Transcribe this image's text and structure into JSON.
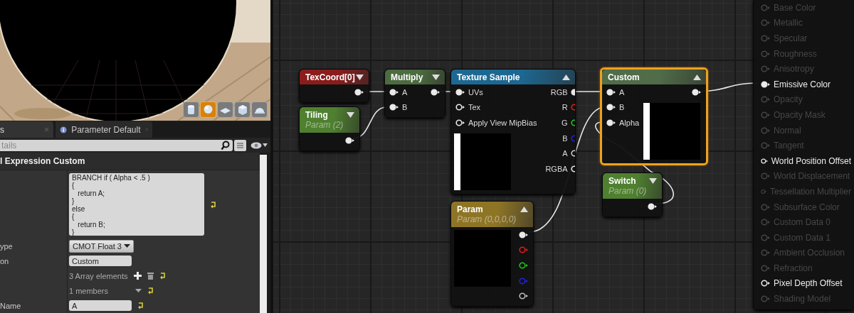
{
  "viewport": {
    "buttons": [
      {
        "selected": false
      },
      {
        "selected": true
      },
      {
        "selected": false
      },
      {
        "selected": false
      },
      {
        "selected": false
      }
    ]
  },
  "tabs": [
    {
      "label": "s",
      "selected": true
    },
    {
      "label": "Parameter Default",
      "selected": false
    }
  ],
  "search": {
    "placeholder": "tails"
  },
  "details": {
    "category": "l Expression Custom",
    "rows": [
      {
        "kind": "code",
        "lines": [
          "BRANCH if ( Alpha < .5 )",
          "{",
          "   return A;",
          "}",
          "else",
          "{",
          "   return B;",
          "}"
        ],
        "reset": true
      },
      {
        "kind": "dropdown",
        "label": "ype",
        "value": "CMOT Float 3",
        "reset": false
      },
      {
        "kind": "text",
        "label": "on",
        "value": "Custom",
        "reset": false
      },
      {
        "kind": "array",
        "text": "3 Array elements",
        "reset": true
      },
      {
        "kind": "members",
        "text": "1 members",
        "reset": true
      },
      {
        "kind": "text",
        "label": "Name",
        "value": "A",
        "reset": true
      }
    ]
  },
  "graph": {
    "nodes": [
      {
        "kind": "texcoord",
        "title": "TexCoord[0]",
        "preview": false,
        "selected": false,
        "outputs": [
          {
            "connected": true
          }
        ]
      },
      {
        "kind": "param",
        "title": "Tiling",
        "subtitle": "Param (2)",
        "preview": false,
        "selected": false,
        "outputs": [
          {
            "connected": true
          }
        ]
      },
      {
        "kind": "math",
        "title": "Multiply",
        "preview": false,
        "selected": false,
        "inputs": [
          {
            "label": "A",
            "connected": true
          },
          {
            "label": "B",
            "connected": true
          }
        ],
        "outputs": [
          {
            "connected": true
          }
        ]
      },
      {
        "kind": "texture",
        "title": "Texture Sample",
        "preview": true,
        "selected": false,
        "inputs": [
          {
            "label": "UVs",
            "connected": true
          },
          {
            "label": "Tex",
            "connected": false
          },
          {
            "label": "Apply View MipBias",
            "connected": false
          }
        ],
        "outputs": [
          {
            "label": "RGB",
            "connected": true,
            "color": "#e8e8e8"
          },
          {
            "label": "R",
            "connected": false,
            "color": "#e01c1c"
          },
          {
            "label": "G",
            "connected": false,
            "color": "#1cc81c"
          },
          {
            "label": "B",
            "connected": false,
            "color": "#2020e0"
          },
          {
            "label": "A",
            "connected": false,
            "color": "#d0d0d0"
          },
          {
            "label": "RGBA",
            "connected": false,
            "color": "#e8e8e8"
          }
        ]
      },
      {
        "kind": "vector",
        "title": "Param",
        "subtitle": "Param (0,0,0,0)",
        "preview": true,
        "selected": false,
        "outputs": [
          {
            "connected": true,
            "color": "#e8e8e8"
          },
          {
            "connected": false,
            "color": "#e01c1c"
          },
          {
            "connected": false,
            "color": "#1cc81c"
          },
          {
            "connected": false,
            "color": "#2020e0"
          },
          {
            "connected": false,
            "color": "#bdbdbd"
          }
        ]
      },
      {
        "kind": "custom",
        "title": "Custom",
        "preview": true,
        "selected": true,
        "inputs": [
          {
            "label": "A",
            "connected": true
          },
          {
            "label": "B",
            "connected": true
          },
          {
            "label": "Alpha",
            "connected": true
          }
        ],
        "outputs": [
          {
            "connected": true
          }
        ]
      },
      {
        "kind": "switch",
        "title": "Switch",
        "subtitle": "Param (0)",
        "preview": false,
        "selected": false,
        "outputs": [
          {
            "connected": true
          }
        ]
      },
      {
        "kind": "result",
        "inputs": [
          {
            "label": "Base Color",
            "enabled": false,
            "connected": false
          },
          {
            "label": "Metallic",
            "enabled": false,
            "connected": false
          },
          {
            "label": "Specular",
            "enabled": false,
            "connected": false
          },
          {
            "label": "Roughness",
            "enabled": false,
            "connected": false
          },
          {
            "label": "Anisotropy",
            "enabled": false,
            "connected": false
          },
          {
            "label": "Emissive Color",
            "enabled": true,
            "connected": true
          },
          {
            "label": "Opacity",
            "enabled": false,
            "connected": false
          },
          {
            "label": "Opacity Mask",
            "enabled": false,
            "connected": false
          },
          {
            "label": "Normal",
            "enabled": false,
            "connected": false
          },
          {
            "label": "Tangent",
            "enabled": false,
            "connected": false
          },
          {
            "label": "World Position Offset",
            "enabled": true,
            "connected": false
          },
          {
            "label": "World Displacement",
            "enabled": false,
            "connected": false
          },
          {
            "label": "Tessellation Multiplier",
            "enabled": false,
            "connected": false
          },
          {
            "label": "Subsurface Color",
            "enabled": false,
            "connected": false
          },
          {
            "label": "Custom Data 0",
            "enabled": false,
            "connected": false
          },
          {
            "label": "Custom Data 1",
            "enabled": false,
            "connected": false
          },
          {
            "label": "Ambient Occlusion",
            "enabled": false,
            "connected": false
          },
          {
            "label": "Refraction",
            "enabled": false,
            "connected": false
          },
          {
            "label": "Pixel Depth Offset",
            "enabled": true,
            "connected": false
          },
          {
            "label": "Shading Model",
            "enabled": false,
            "connected": false
          }
        ]
      }
    ]
  }
}
